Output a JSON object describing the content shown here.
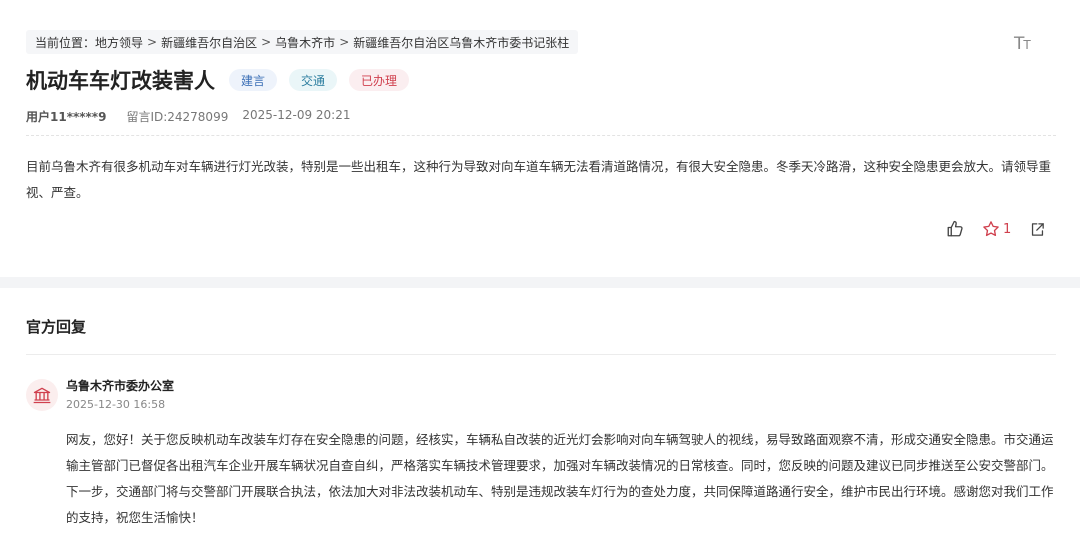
{
  "breadcrumb": {
    "prefix": "当前位置：",
    "items": [
      "地方领导",
      "新疆维吾尔自治区",
      "乌鲁木齐市",
      "新疆维吾尔自治区乌鲁木齐市委书记张柱"
    ],
    "separator": ">"
  },
  "font_size_control": {
    "big": "T",
    "small": "T"
  },
  "post": {
    "title": "机动车车灯改装害人",
    "tags": [
      "建言",
      "交通",
      "已办理"
    ],
    "user": "用户11*****9",
    "message_id": "留言ID:24278099",
    "datetime": "2025-12-09 20:21",
    "content": "目前乌鲁木齐有很多机动车对车辆进行灯光改装，特别是一些出租车，这种行为导致对向车道车辆无法看清道路情况，有很大安全隐患。冬季天冷路滑，这种安全隐患更会放大。请领导重视、严查。",
    "favorite_count": "1"
  },
  "reply_section": {
    "title": "官方回复",
    "org_name": "乌鲁木齐市委办公室",
    "datetime": "2025-12-30 16:58",
    "content": "网友，您好！关于您反映机动车改装车灯存在安全隐患的问题，经核实，车辆私自改装的近光灯会影响对向车辆驾驶人的视线，易导致路面观察不清，形成交通安全隐患。市交通运输主管部门已督促各出租汽车企业开展车辆状况自查自纠，严格落实车辆技术管理要求，加强对车辆改装情况的日常核查。同时，您反映的问题及建议已同步推送至公安交警部门。下一步，交通部门将与交警部门开展联合执法，依法加大对非法改装机动车、特别是违规改装车灯行为的查处力度，共同保障道路通行安全，维护市民出行环境。感谢您对我们工作的支持，祝您生活愉快！"
  },
  "colors": {
    "accent_red": "#d0404e",
    "tag_blue": "#3b6fb6",
    "tag_cyan": "#2e7fa0"
  },
  "icons": [
    "thumb-up-icon",
    "star-icon",
    "share-icon",
    "government-building-icon",
    "font-size-icon"
  ]
}
